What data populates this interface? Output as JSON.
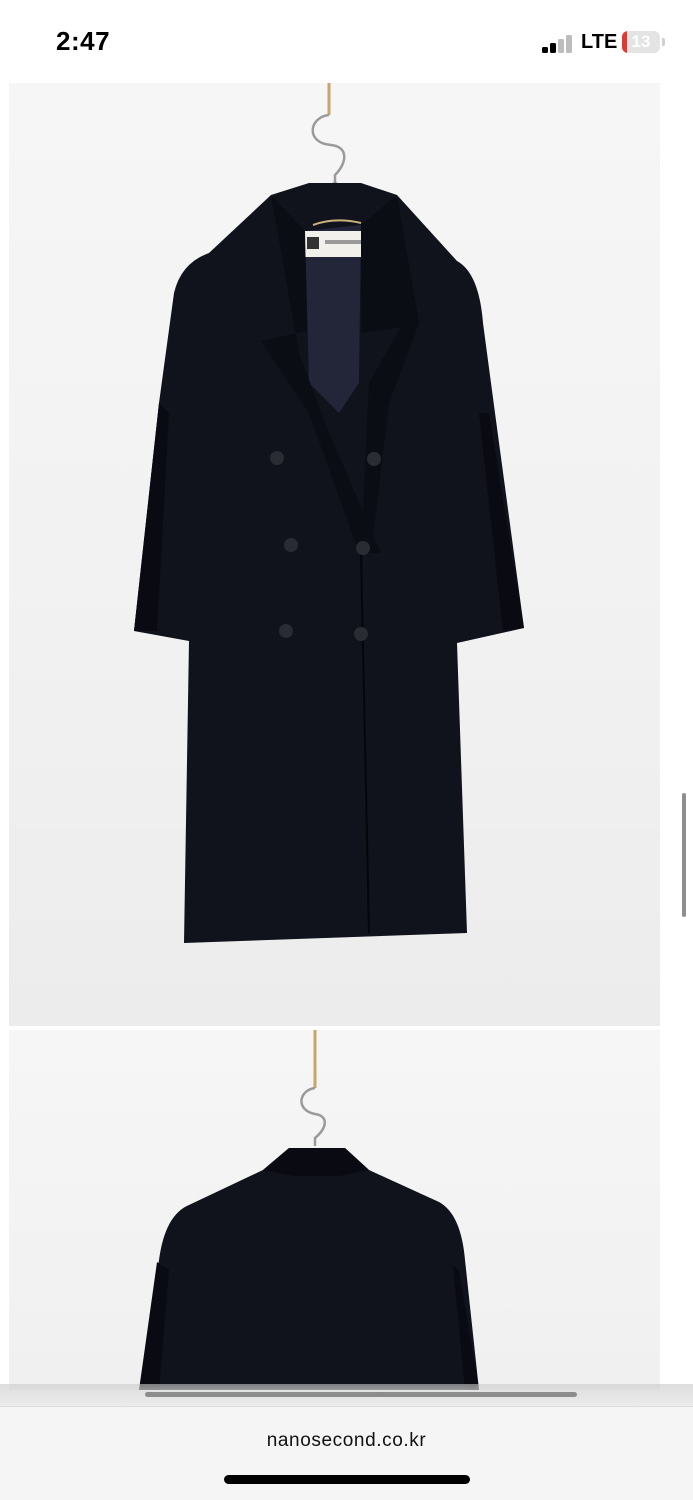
{
  "status_bar": {
    "time": "2:47",
    "network": "LTE",
    "battery_level": "13",
    "battery_color": "#e5382d"
  },
  "gallery": {
    "photos": [
      {
        "subject": "coat-front"
      },
      {
        "subject": "coat-back"
      }
    ],
    "coat_color": "#10121c"
  },
  "browser": {
    "url": "nanosecond.co.kr"
  }
}
